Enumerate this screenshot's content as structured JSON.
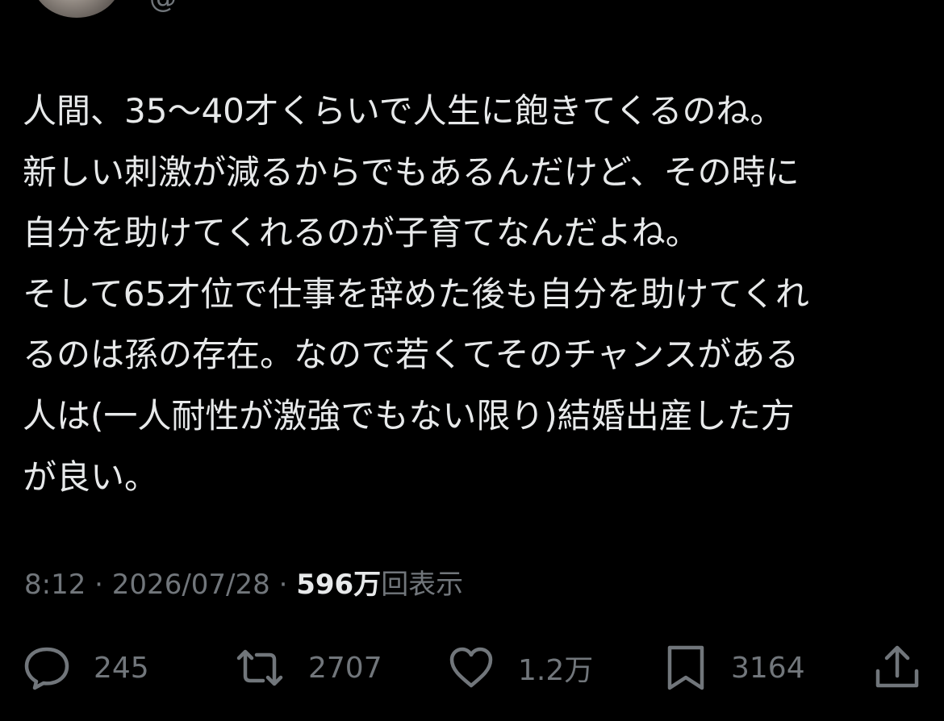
{
  "tweet": {
    "lines": [
      "人間、35〜40才くらいで人生に飽きてくるのね。",
      "新しい刺激が減るからでもあるんだけど、その時に",
      "自分を助けてくれるのが子育てなんだよね。",
      "そして65才位で仕事を辞めた後も自分を助けてくれ",
      "るのは孫の存在。なので若くてそのチャンスがある",
      "人は(一人耐性が激強でもない限り)結婚出産した方",
      "が良い。"
    ],
    "time": "8:12",
    "separator": " · ",
    "date": "2026/07/28",
    "views_count": "596万",
    "views_label": "回表示"
  },
  "actions": {
    "reply": {
      "icon": "reply-icon",
      "count": "245"
    },
    "retweet": {
      "icon": "retweet-icon",
      "count": "2707"
    },
    "like": {
      "icon": "heart-icon",
      "count": "1.2万"
    },
    "bookmark": {
      "icon": "bookmark-icon",
      "count": "3164"
    },
    "share": {
      "icon": "share-icon"
    }
  },
  "colors": {
    "background": "#000000",
    "text": "#e7e9ea",
    "secondary": "#71767b"
  }
}
